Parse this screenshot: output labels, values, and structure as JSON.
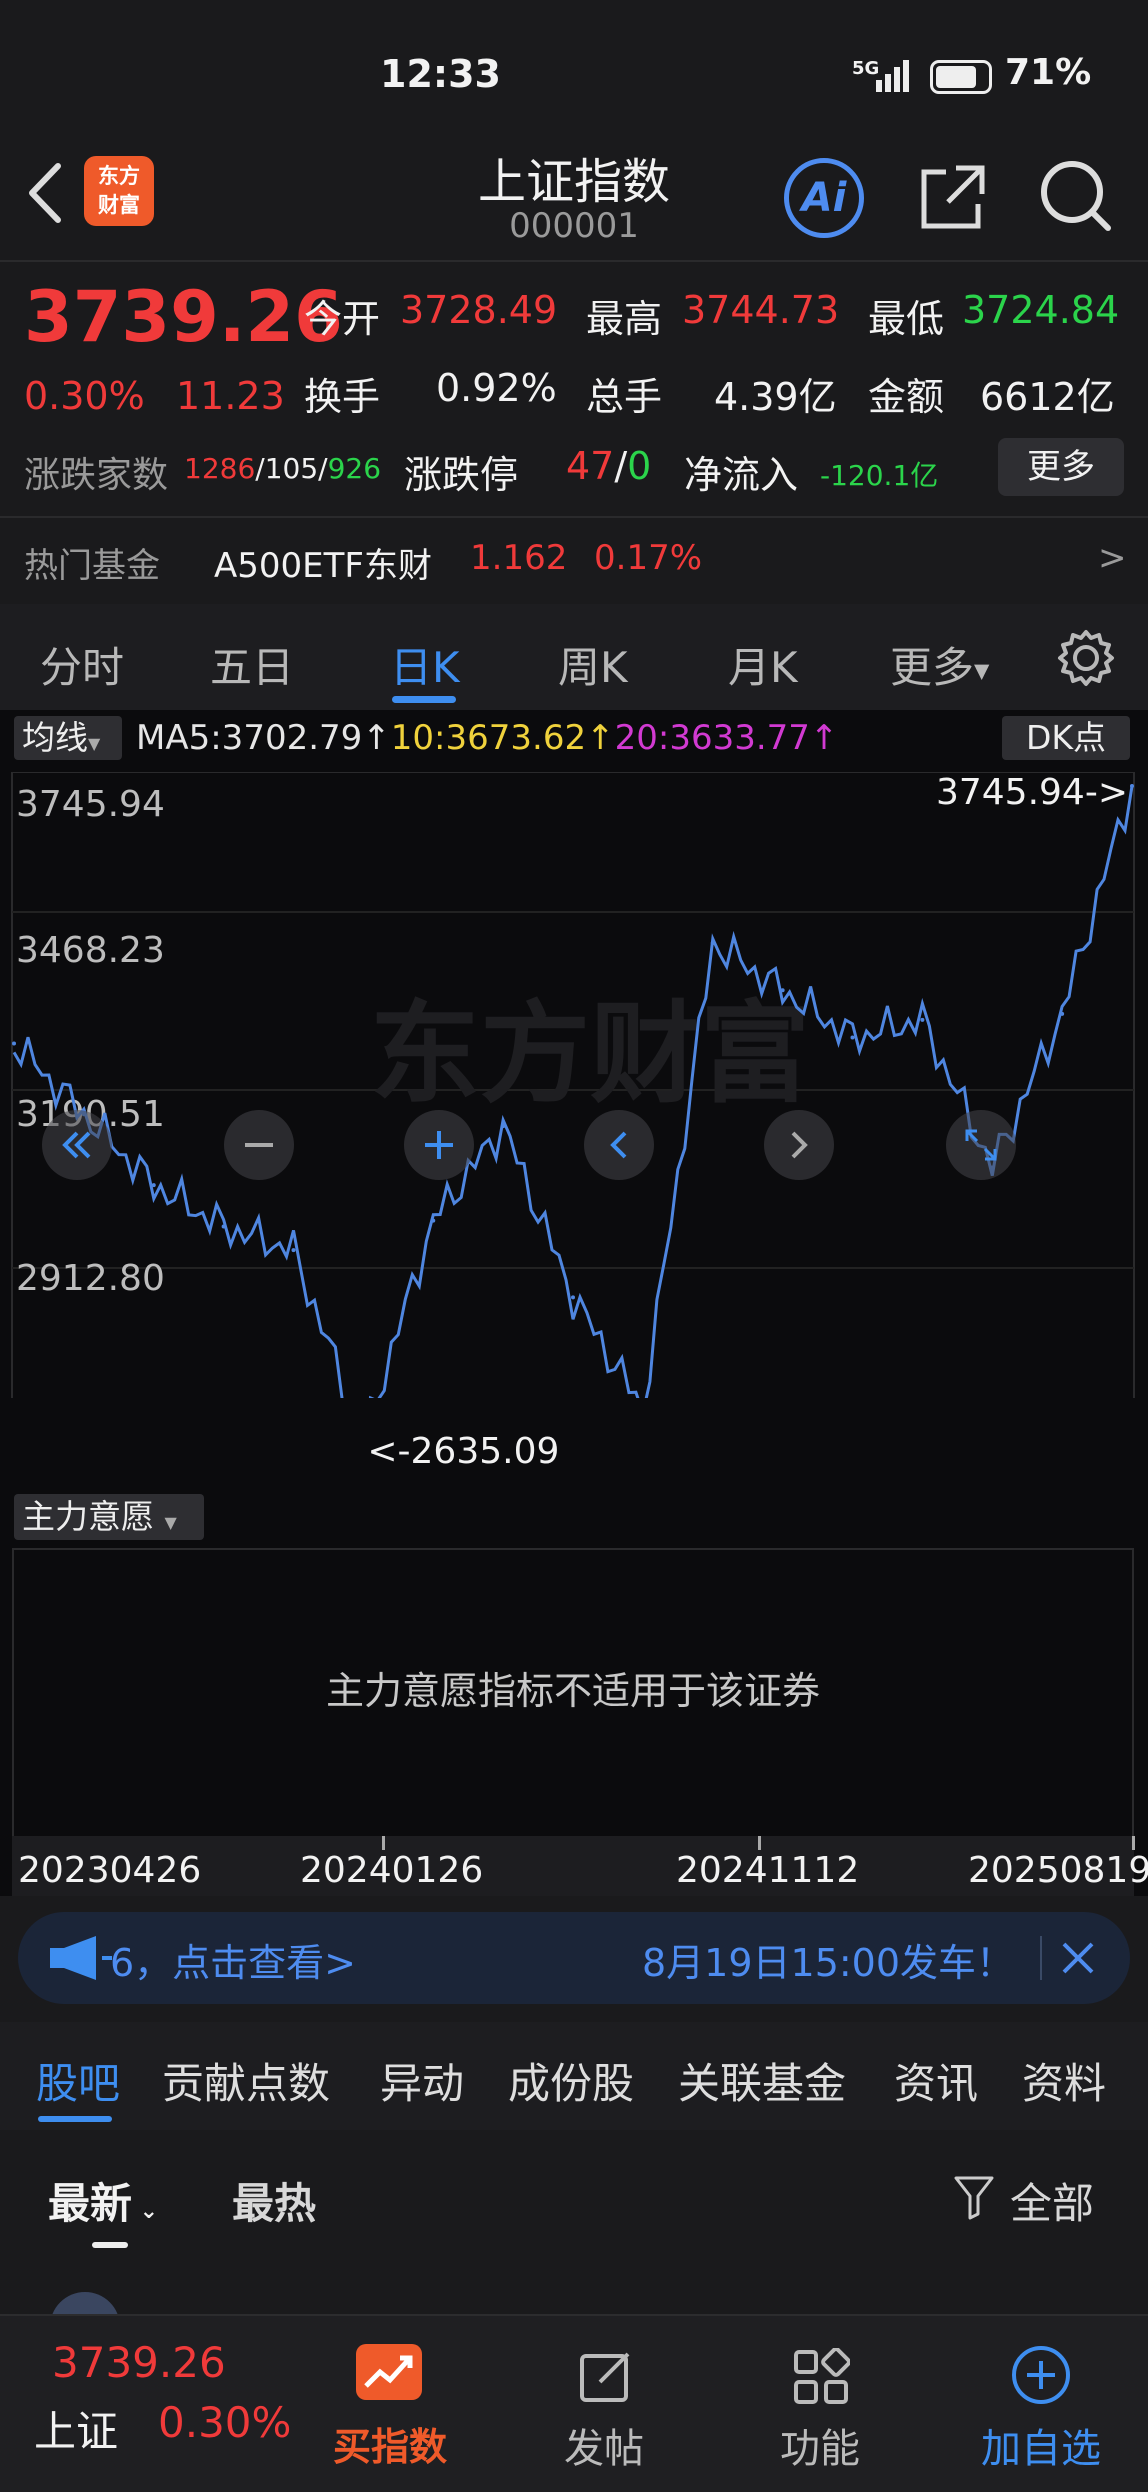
{
  "status_bar": {
    "time": "12:33",
    "network": "5G",
    "battery": "71%"
  },
  "header": {
    "logo_line1": "东方",
    "logo_line2": "财富",
    "title": "上证指数",
    "code": "000001",
    "ai_label": "Ai"
  },
  "quote": {
    "price": "3739.26",
    "change_pct": "0.30%",
    "change_abs": "11.23",
    "open_label": "今开",
    "open": "3728.49",
    "high_label": "最高",
    "high": "3744.73",
    "low_label": "最低",
    "low": "3724.84",
    "turnover_label": "换手",
    "turnover": "0.92%",
    "volume_label": "总手",
    "volume": "4.39亿",
    "amount_label": "金额",
    "amount": "6612亿",
    "breadth_label": "涨跌家数",
    "breadth_up": "1286",
    "breadth_flat": "105",
    "breadth_down": "926",
    "slash": "/",
    "limit_label": "涨跌停",
    "limit_up": "47",
    "limit_down": "0",
    "netflow_label": "净流入",
    "netflow": "-120.1亿",
    "more_button": "更多"
  },
  "hot_fund": {
    "label": "热门基金",
    "name": "A500ETF东财",
    "price": "1.162",
    "pct": "0.17%",
    "arrow": ">"
  },
  "period_tabs": [
    {
      "label": "分时"
    },
    {
      "label": "五日"
    },
    {
      "label": "日K"
    },
    {
      "label": "周K"
    },
    {
      "label": "月K"
    },
    {
      "label": "更多"
    }
  ],
  "active_tab_index": 2,
  "ma_bar": {
    "selector": "均线",
    "ma5": "MA5:3702.79↑",
    "ma10": "10:3673.62↑",
    "ma20": "20:3633.77↑",
    "dk_button": "DK点"
  },
  "colors": {
    "ma5": "#e6e6e6",
    "ma10": "#f0d23c",
    "ma20": "#d23ad2",
    "line": "#4f86e0",
    "up": "#f03a3a",
    "down": "#2bd44b",
    "accent": "#3e8ef0"
  },
  "chart": {
    "max_label": "3745.94->",
    "min_label": "<-2635.09",
    "y_ticks": [
      "3745.94",
      "3468.23",
      "3190.51",
      "2912.80",
      "2635.09"
    ],
    "x_ticks": [
      "20230426",
      "20240126",
      "20241112",
      "20250819"
    ],
    "watermark": "东方财富",
    "indicator_selector": "主力意愿",
    "indicator_message": "主力意愿指标不适用于该证券"
  },
  "chart_data": {
    "type": "line",
    "title": "",
    "xlabel": "",
    "ylabel": "",
    "ylim": [
      2635.09,
      3745.94
    ],
    "x_ticks": [
      "20230426",
      "20240126",
      "20241112",
      "20250819"
    ],
    "x": [
      "20230426",
      "20230601",
      "20230801",
      "20231001",
      "20231201",
      "20240126",
      "20240301",
      "20240520",
      "20240801",
      "20240924",
      "20241008",
      "20241112",
      "20250101",
      "20250301",
      "20250407",
      "20250601",
      "20250819"
    ],
    "values": [
      3310,
      3190,
      3070,
      3000,
      2960,
      2640,
      3010,
      3170,
      2880,
      2690,
      3480,
      3400,
      3320,
      3350,
      3100,
      3360,
      3746
    ]
  },
  "banner": {
    "left_text": "6，点击查看>",
    "right_text": "8月19日15:00发车！"
  },
  "content_tabs": [
    {
      "label": "股吧"
    },
    {
      "label": "贡献点数"
    },
    {
      "label": "异动"
    },
    {
      "label": "成份股"
    },
    {
      "label": "关联基金"
    },
    {
      "label": "资讯"
    },
    {
      "label": "资料"
    }
  ],
  "filters": {
    "latest": "最新",
    "hot": "最热",
    "all": "全部"
  },
  "bottom_nav": {
    "index_price": "3739.26",
    "index_name": "上证",
    "index_pct": "0.30%",
    "buy_index": "买指数",
    "post": "发帖",
    "functions": "功能",
    "add_watch": "加自选"
  }
}
